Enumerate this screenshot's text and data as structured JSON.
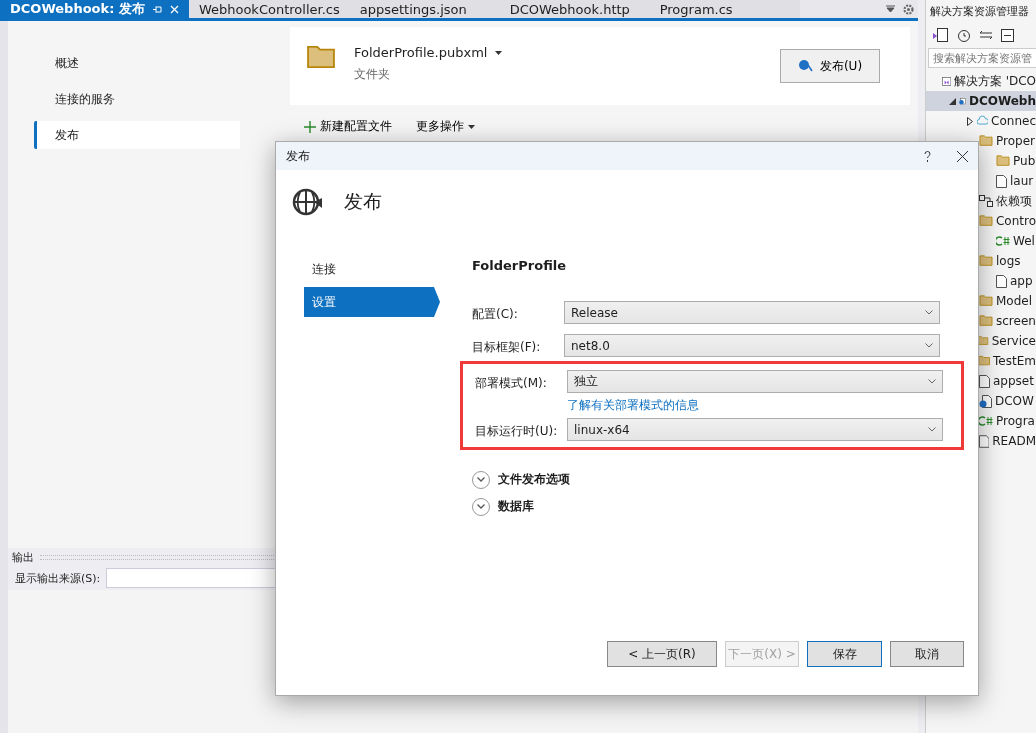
{
  "tabs": [
    {
      "label": "DCOWebhook: 发布",
      "selected": true
    },
    {
      "label": "WebhookController.cs",
      "selected": false
    },
    {
      "label": "appsettings.json",
      "selected": false
    },
    {
      "label": "DCOWebhook.http",
      "selected": false
    },
    {
      "label": "Program.cs",
      "selected": false
    }
  ],
  "nav": [
    {
      "label": "概述",
      "selected": false
    },
    {
      "label": "连接的服务",
      "selected": false
    },
    {
      "label": "发布",
      "selected": true
    }
  ],
  "profile": {
    "name": "FolderProfile.pubxml",
    "type": "文件夹",
    "publish_button": "发布(U)"
  },
  "actions": [
    {
      "label": "新建配置文件",
      "kind": "add"
    },
    {
      "label": "更多操作",
      "kind": "menu"
    }
  ],
  "output": {
    "title": "输出",
    "source_label": "显示输出来源(S):"
  },
  "explorer": {
    "title": "解决方案资源管理器",
    "search_placeholder": "搜索解决方案资源管",
    "tree": [
      {
        "label": "解决方案 'DCO",
        "kind": "solution",
        "children": [
          {
            "label": "DCOWebh",
            "kind": "project",
            "expanded": true,
            "selected": true,
            "children": [
              {
                "label": "Connec",
                "kind": "cloud",
                "expanded": false
              },
              {
                "label": "Proper",
                "kind": "folder",
                "children": [
                  {
                    "label": "Pub",
                    "kind": "folder"
                  },
                  {
                    "label": "laur",
                    "kind": "json"
                  }
                ]
              },
              {
                "label": "依赖项",
                "kind": "deps"
              },
              {
                "label": "Contro",
                "kind": "folder",
                "children": [
                  {
                    "label": "Wel",
                    "kind": "csharp"
                  }
                ]
              },
              {
                "label": "logs",
                "kind": "folder",
                "children": [
                  {
                    "label": "app",
                    "kind": "file"
                  }
                ]
              },
              {
                "label": "Model",
                "kind": "folder"
              },
              {
                "label": "screen",
                "kind": "folder"
              },
              {
                "label": "Service",
                "kind": "folder"
              },
              {
                "label": "TestEm",
                "kind": "folder"
              },
              {
                "label": "appset",
                "kind": "json"
              },
              {
                "label": "DCOW",
                "kind": "http"
              },
              {
                "label": "Progra",
                "kind": "csharp"
              },
              {
                "label": "READM",
                "kind": "file"
              }
            ]
          }
        ]
      }
    ]
  },
  "dialog": {
    "title": "发布",
    "heading": "发布",
    "steps": [
      {
        "label": "连接",
        "selected": false
      },
      {
        "label": "设置",
        "selected": true
      }
    ],
    "profile_name": "FolderProfile",
    "field_groups": [
      {
        "highlighted": false,
        "fields": [
          {
            "label": "配置(C):",
            "value": "Release"
          },
          {
            "label": "目标框架(F):",
            "value": "net8.0"
          }
        ]
      },
      {
        "highlighted": true,
        "fields": [
          {
            "label": "部署模式(M):",
            "value": "独立",
            "link": "了解有关部署模式的信息"
          },
          {
            "label": "目标运行时(U):",
            "value": "linux-x64"
          }
        ]
      }
    ],
    "sections": [
      {
        "label": "文件发布选项",
        "expanded": false
      },
      {
        "label": "数据库",
        "expanded": false
      }
    ],
    "buttons": [
      {
        "label": "< 上一页(R)",
        "kind": "normal",
        "disabled": false
      },
      {
        "label": "下一页(X) >",
        "kind": "normal",
        "disabled": true
      },
      {
        "label": "保存",
        "kind": "default",
        "disabled": false
      },
      {
        "label": "取消",
        "kind": "normal",
        "disabled": false
      }
    ]
  }
}
